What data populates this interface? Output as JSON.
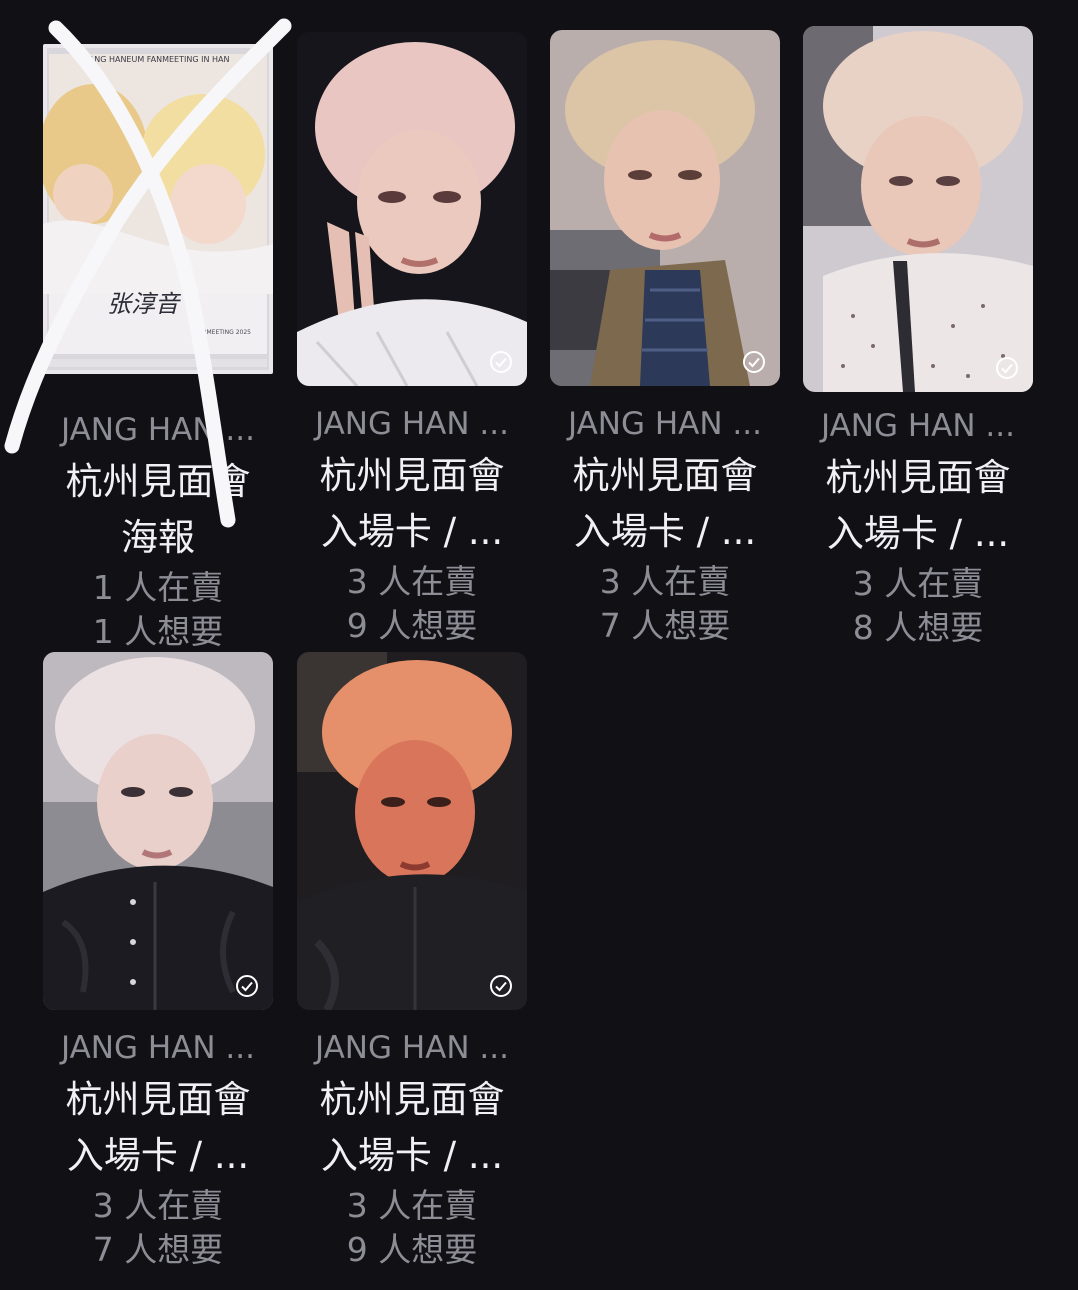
{
  "colors": {
    "background": "#111015",
    "title_text": "#f1f1f4",
    "meta_text": "#8d8d96",
    "check_icon": "#ffffff"
  },
  "items": [
    {
      "subtitle": "JANG HAN ...",
      "title_line1": "杭州見面會",
      "title_line2": "海報",
      "sellers": "1 人在賣",
      "wants": "1 人想要",
      "image": "poster-photo",
      "poster_header": "JANG HANEUM FANMEETING IN HAN",
      "poster_signature": "张淳音",
      "poster_footer": "FANMEETING 2025",
      "collected": false,
      "crossed_out": true
    },
    {
      "subtitle": "JANG HAN ...",
      "title_line1": "杭州見面會",
      "title_line2": "入場卡 / ...",
      "sellers": "3 人在賣",
      "wants": "9 人想要",
      "image": "photocard-peace-sign",
      "collected": true,
      "crossed_out": false
    },
    {
      "subtitle": "JANG HAN ...",
      "title_line1": "杭州見面會",
      "title_line2": "入場卡 / ...",
      "sellers": "3 人在賣",
      "wants": "7 人想要",
      "image": "photocard-plaid-shirt",
      "collected": true,
      "crossed_out": false
    },
    {
      "subtitle": "JANG HAN ...",
      "title_line1": "杭州見面會",
      "title_line2": "入場卡 / ...",
      "sellers": "3 人在賣",
      "wants": "8 人想要",
      "image": "photocard-knit-sweater",
      "collected": true,
      "crossed_out": false
    },
    {
      "subtitle": "JANG HAN ...",
      "title_line1": "杭州見面會",
      "title_line2": "入場卡 / ...",
      "sellers": "3 人在賣",
      "wants": "7 人想要",
      "image": "photocard-leather-jacket",
      "collected": true,
      "crossed_out": false
    },
    {
      "subtitle": "JANG HAN ...",
      "title_line1": "杭州見面會",
      "title_line2": "入場卡 / ...",
      "sellers": "3 人在賣",
      "wants": "9 人想要",
      "image": "photocard-orange-light",
      "collected": true,
      "crossed_out": false
    }
  ]
}
